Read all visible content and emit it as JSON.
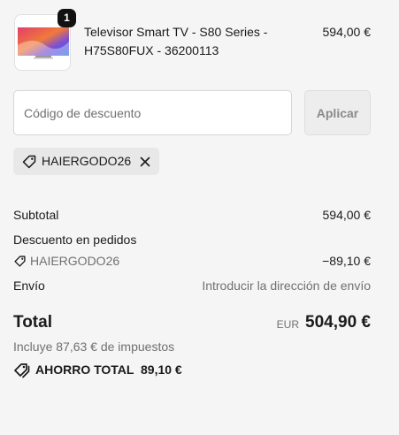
{
  "product": {
    "quantity": "1",
    "name": "Televisor Smart TV - S80 Series - H75S80FUX - 36200113",
    "price": "594,00 €"
  },
  "discount": {
    "placeholder": "Código de descuento",
    "value": "",
    "apply_label": "Aplicar",
    "applied_code": "HAIERGODO26"
  },
  "summary": {
    "subtotal_label": "Subtotal",
    "subtotal_value": "594,00 €",
    "order_discount_label": "Descuento en pedidos",
    "order_discount_code": "HAIERGODO26",
    "order_discount_value": "−89,10 €",
    "shipping_label": "Envío",
    "shipping_value": "Introducir la dirección de envío",
    "total_label": "Total",
    "currency": "EUR",
    "total_value": "504,90 €",
    "taxes_note": "Incluye 87,63 € de impuestos",
    "savings_label": "AHORRO TOTAL",
    "savings_value": "89,10 €"
  },
  "icons": {
    "chip_tag": "tag-icon",
    "chip_remove": "close-icon",
    "discount_tag": "tag-icon",
    "savings": "tags-icon"
  },
  "colors": {
    "background": "#f5f5f5",
    "text": "#1a1a1a",
    "muted": "#707070",
    "badge": "#111111"
  }
}
